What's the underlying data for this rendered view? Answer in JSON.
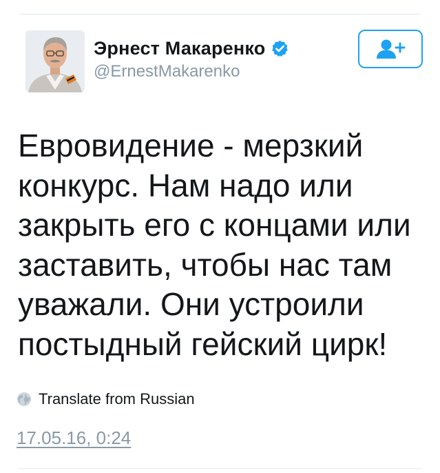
{
  "tweet": {
    "author": {
      "display_name": "Эрнест Макаренко",
      "handle": "@ErnestMakarenko",
      "verified": true,
      "avatar_icon": "user-avatar-photo"
    },
    "follow_button": {
      "icon": "add-user-icon"
    },
    "text_lines": [
      "Евровидение - мерзкий",
      "конкурс. Нам надо или",
      "закрыть его с концами или",
      "заставить, чтобы нас там",
      "уважали. Они устроили",
      "постыдный гейский цирк!"
    ],
    "translate": {
      "label": "Translate from Russian",
      "icon": "globe-icon"
    },
    "timestamp": "17.05.16, 0:24"
  },
  "colors": {
    "accent": "#1da1f2",
    "text": "#14171a",
    "secondary_text": "#8899a6",
    "divider": "#e1e8ed"
  }
}
